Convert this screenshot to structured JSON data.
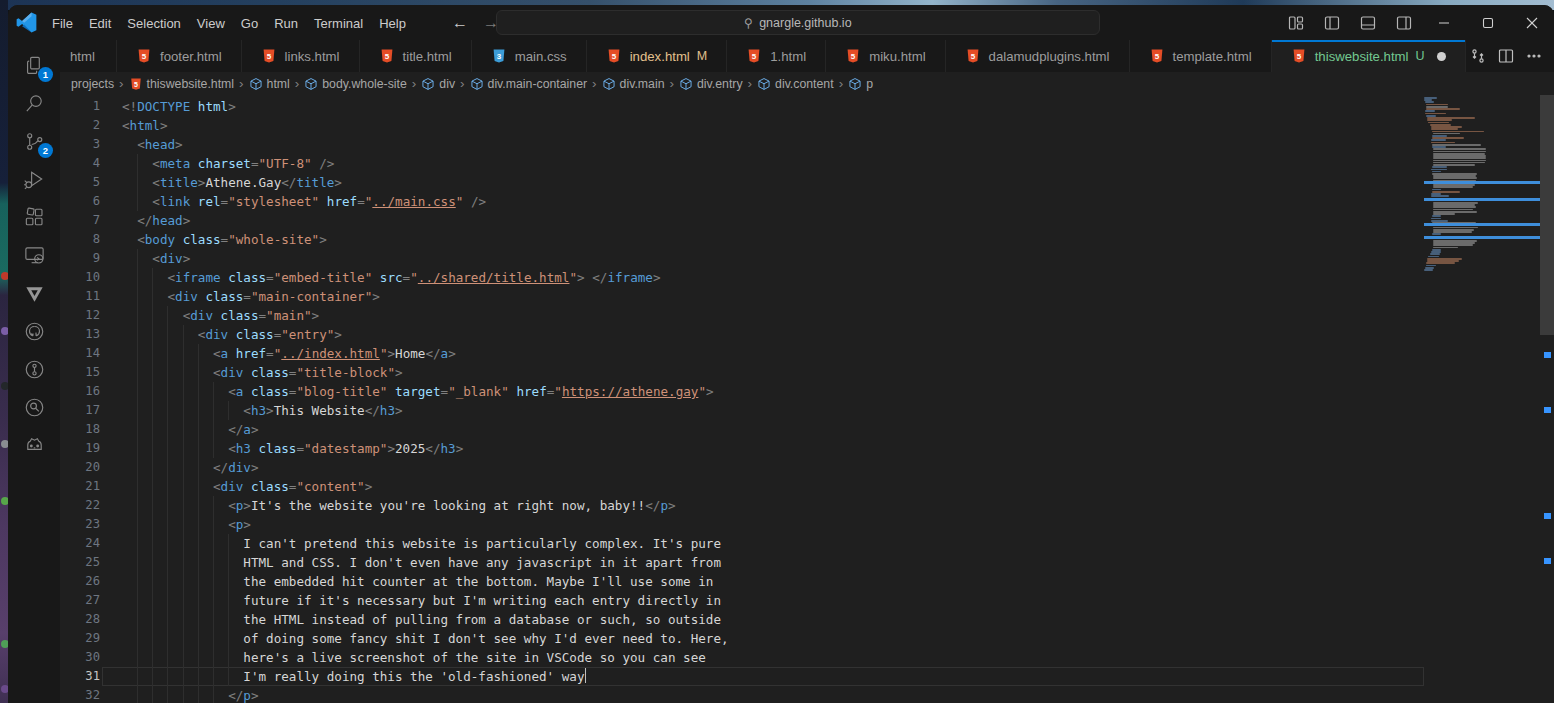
{
  "window": {
    "menu_items": [
      "File",
      "Edit",
      "Selection",
      "View",
      "Go",
      "Run",
      "Terminal",
      "Help"
    ],
    "command_center": "gnargle.github.io",
    "controls": [
      "minimize",
      "maximize",
      "close"
    ],
    "layout_controls": [
      "customize-layout",
      "toggle-primary-sidebar",
      "toggle-panel",
      "toggle-secondary-sidebar"
    ]
  },
  "activity_bar": {
    "items": [
      {
        "name": "explorer",
        "badge": "1"
      },
      {
        "name": "search",
        "badge": null
      },
      {
        "name": "source-control",
        "badge": "2"
      },
      {
        "name": "run-and-debug",
        "badge": null
      },
      {
        "name": "extensions",
        "badge": null
      },
      {
        "name": "remote-explorer",
        "badge": null
      },
      {
        "name": "triangle-logo",
        "badge": null
      },
      {
        "name": "github",
        "badge": null
      },
      {
        "name": "gitlens",
        "badge": null
      },
      {
        "name": "gitlens-search",
        "badge": null
      },
      {
        "name": "godot-tools",
        "badge": null
      }
    ]
  },
  "tabs": [
    {
      "label": "html",
      "icon": null,
      "badge": null,
      "git": null,
      "active": false,
      "dirty": false,
      "truncated": true
    },
    {
      "label": "footer.html",
      "icon": "html",
      "badge": null,
      "git": null,
      "active": false,
      "dirty": false
    },
    {
      "label": "links.html",
      "icon": "html",
      "badge": null,
      "git": null,
      "active": false,
      "dirty": false
    },
    {
      "label": "title.html",
      "icon": "html",
      "badge": null,
      "git": null,
      "active": false,
      "dirty": false
    },
    {
      "label": "main.css",
      "icon": "css",
      "badge": null,
      "git": null,
      "active": false,
      "dirty": false
    },
    {
      "label": "index.html",
      "icon": "html",
      "badge": "M",
      "git": "modified",
      "active": false,
      "dirty": false
    },
    {
      "label": "1.html",
      "icon": "html",
      "badge": null,
      "git": null,
      "active": false,
      "dirty": false
    },
    {
      "label": "miku.html",
      "icon": "html",
      "badge": null,
      "git": null,
      "active": false,
      "dirty": false
    },
    {
      "label": "dalamudplugins.html",
      "icon": "html",
      "badge": null,
      "git": null,
      "active": false,
      "dirty": false
    },
    {
      "label": "template.html",
      "icon": "html",
      "badge": null,
      "git": null,
      "active": false,
      "dirty": false
    },
    {
      "label": "thiswebsite.html",
      "icon": "html",
      "badge": "U",
      "git": "untracked",
      "active": true,
      "dirty": true
    }
  ],
  "editor_actions": [
    "open-changes",
    "split-editor",
    "more-actions"
  ],
  "breadcrumbs": [
    {
      "label": "projects",
      "icon": null
    },
    {
      "label": "thiswebsite.html",
      "icon": "html"
    },
    {
      "label": "html",
      "icon": "symbol"
    },
    {
      "label": "body.whole-site",
      "icon": "symbol"
    },
    {
      "label": "div",
      "icon": "symbol"
    },
    {
      "label": "div.main-container",
      "icon": "symbol"
    },
    {
      "label": "div.main",
      "icon": "symbol"
    },
    {
      "label": "div.entry",
      "icon": "symbol"
    },
    {
      "label": "div.content",
      "icon": "symbol"
    },
    {
      "label": "p",
      "icon": "symbol"
    }
  ],
  "editor": {
    "current_line": 31,
    "lines": [
      {
        "n": 1,
        "i": 0,
        "tokens": [
          [
            "p",
            "<!"
          ],
          [
            "t",
            "DOCTYPE"
          ],
          [
            "x",
            " "
          ],
          [
            "a",
            "html"
          ],
          [
            "p",
            ">"
          ]
        ]
      },
      {
        "n": 2,
        "i": 0,
        "tokens": [
          [
            "p",
            "<"
          ],
          [
            "t",
            "html"
          ],
          [
            "p",
            ">"
          ]
        ]
      },
      {
        "n": 3,
        "i": 2,
        "tokens": [
          [
            "p",
            "<"
          ],
          [
            "t",
            "head"
          ],
          [
            "p",
            ">"
          ]
        ]
      },
      {
        "n": 4,
        "i": 4,
        "tokens": [
          [
            "p",
            "<"
          ],
          [
            "t",
            "meta"
          ],
          [
            "x",
            " "
          ],
          [
            "a",
            "charset"
          ],
          [
            "p",
            "="
          ],
          [
            "s",
            "\"UTF-8\""
          ],
          [
            "x",
            " "
          ],
          [
            "p",
            "/>"
          ]
        ]
      },
      {
        "n": 5,
        "i": 4,
        "tokens": [
          [
            "p",
            "<"
          ],
          [
            "t",
            "title"
          ],
          [
            "p",
            ">"
          ],
          [
            "x",
            "Athene.Gay"
          ],
          [
            "p",
            "</"
          ],
          [
            "t",
            "title"
          ],
          [
            "p",
            ">"
          ]
        ]
      },
      {
        "n": 6,
        "i": 4,
        "tokens": [
          [
            "p",
            "<"
          ],
          [
            "t",
            "link"
          ],
          [
            "x",
            " "
          ],
          [
            "a",
            "rel"
          ],
          [
            "p",
            "="
          ],
          [
            "s",
            "\"stylesheet\""
          ],
          [
            "x",
            " "
          ],
          [
            "a",
            "href"
          ],
          [
            "p",
            "="
          ],
          [
            "s",
            "\""
          ],
          [
            "l",
            "../main.css"
          ],
          [
            "s",
            "\""
          ],
          [
            "x",
            " "
          ],
          [
            "p",
            "/>"
          ]
        ]
      },
      {
        "n": 7,
        "i": 2,
        "tokens": [
          [
            "p",
            "</"
          ],
          [
            "t",
            "head"
          ],
          [
            "p",
            ">"
          ]
        ]
      },
      {
        "n": 8,
        "i": 2,
        "tokens": [
          [
            "p",
            "<"
          ],
          [
            "t",
            "body"
          ],
          [
            "x",
            " "
          ],
          [
            "a",
            "class"
          ],
          [
            "p",
            "="
          ],
          [
            "s",
            "\"whole-site\""
          ],
          [
            "p",
            ">"
          ]
        ]
      },
      {
        "n": 9,
        "i": 4,
        "tokens": [
          [
            "p",
            "<"
          ],
          [
            "t",
            "div"
          ],
          [
            "p",
            ">"
          ]
        ]
      },
      {
        "n": 10,
        "i": 6,
        "tokens": [
          [
            "p",
            "<"
          ],
          [
            "t",
            "iframe"
          ],
          [
            "x",
            " "
          ],
          [
            "a",
            "class"
          ],
          [
            "p",
            "="
          ],
          [
            "s",
            "\"embed-title\""
          ],
          [
            "x",
            " "
          ],
          [
            "a",
            "src"
          ],
          [
            "p",
            "="
          ],
          [
            "s",
            "\""
          ],
          [
            "l",
            "../shared/title.html"
          ],
          [
            "s",
            "\""
          ],
          [
            "p",
            ">"
          ],
          [
            "x",
            " "
          ],
          [
            "p",
            "</"
          ],
          [
            "t",
            "iframe"
          ],
          [
            "p",
            ">"
          ]
        ]
      },
      {
        "n": 11,
        "i": 6,
        "tokens": [
          [
            "p",
            "<"
          ],
          [
            "t",
            "div"
          ],
          [
            "x",
            " "
          ],
          [
            "a",
            "class"
          ],
          [
            "p",
            "="
          ],
          [
            "s",
            "\"main-container\""
          ],
          [
            "p",
            ">"
          ]
        ]
      },
      {
        "n": 12,
        "i": 8,
        "tokens": [
          [
            "p",
            "<"
          ],
          [
            "t",
            "div"
          ],
          [
            "x",
            " "
          ],
          [
            "a",
            "class"
          ],
          [
            "p",
            "="
          ],
          [
            "s",
            "\"main\""
          ],
          [
            "p",
            ">"
          ]
        ]
      },
      {
        "n": 13,
        "i": 10,
        "tokens": [
          [
            "p",
            "<"
          ],
          [
            "t",
            "div"
          ],
          [
            "x",
            " "
          ],
          [
            "a",
            "class"
          ],
          [
            "p",
            "="
          ],
          [
            "s",
            "\"entry\""
          ],
          [
            "p",
            ">"
          ]
        ]
      },
      {
        "n": 14,
        "i": 12,
        "tokens": [
          [
            "p",
            "<"
          ],
          [
            "t",
            "a"
          ],
          [
            "x",
            " "
          ],
          [
            "a",
            "href"
          ],
          [
            "p",
            "="
          ],
          [
            "s",
            "\""
          ],
          [
            "l",
            "../index.html"
          ],
          [
            "s",
            "\""
          ],
          [
            "p",
            ">"
          ],
          [
            "x",
            "Home"
          ],
          [
            "p",
            "</"
          ],
          [
            "t",
            "a"
          ],
          [
            "p",
            ">"
          ]
        ]
      },
      {
        "n": 15,
        "i": 12,
        "tokens": [
          [
            "p",
            "<"
          ],
          [
            "t",
            "div"
          ],
          [
            "x",
            " "
          ],
          [
            "a",
            "class"
          ],
          [
            "p",
            "="
          ],
          [
            "s",
            "\"title-block\""
          ],
          [
            "p",
            ">"
          ]
        ]
      },
      {
        "n": 16,
        "i": 14,
        "tokens": [
          [
            "p",
            "<"
          ],
          [
            "t",
            "a"
          ],
          [
            "x",
            " "
          ],
          [
            "a",
            "class"
          ],
          [
            "p",
            "="
          ],
          [
            "s",
            "\"blog-title\""
          ],
          [
            "x",
            " "
          ],
          [
            "a",
            "target"
          ],
          [
            "p",
            "="
          ],
          [
            "s",
            "\"_blank\""
          ],
          [
            "x",
            " "
          ],
          [
            "a",
            "href"
          ],
          [
            "p",
            "="
          ],
          [
            "s",
            "\""
          ],
          [
            "l",
            "https://athene.gay"
          ],
          [
            "s",
            "\""
          ],
          [
            "p",
            ">"
          ]
        ]
      },
      {
        "n": 17,
        "i": 16,
        "tokens": [
          [
            "p",
            "<"
          ],
          [
            "t",
            "h3"
          ],
          [
            "p",
            ">"
          ],
          [
            "x",
            "This Website"
          ],
          [
            "p",
            "</"
          ],
          [
            "t",
            "h3"
          ],
          [
            "p",
            ">"
          ]
        ]
      },
      {
        "n": 18,
        "i": 14,
        "tokens": [
          [
            "p",
            "</"
          ],
          [
            "t",
            "a"
          ],
          [
            "p",
            ">"
          ]
        ]
      },
      {
        "n": 19,
        "i": 14,
        "tokens": [
          [
            "p",
            "<"
          ],
          [
            "t",
            "h3"
          ],
          [
            "x",
            " "
          ],
          [
            "a",
            "class"
          ],
          [
            "p",
            "="
          ],
          [
            "s",
            "\"datestamp\""
          ],
          [
            "p",
            ">"
          ],
          [
            "x",
            "2025"
          ],
          [
            "p",
            "</"
          ],
          [
            "t",
            "h3"
          ],
          [
            "p",
            ">"
          ]
        ]
      },
      {
        "n": 20,
        "i": 12,
        "tokens": [
          [
            "p",
            "</"
          ],
          [
            "t",
            "div"
          ],
          [
            "p",
            ">"
          ]
        ]
      },
      {
        "n": 21,
        "i": 12,
        "tokens": [
          [
            "p",
            "<"
          ],
          [
            "t",
            "div"
          ],
          [
            "x",
            " "
          ],
          [
            "a",
            "class"
          ],
          [
            "p",
            "="
          ],
          [
            "s",
            "\"content\""
          ],
          [
            "p",
            ">"
          ]
        ]
      },
      {
        "n": 22,
        "i": 14,
        "tokens": [
          [
            "p",
            "<"
          ],
          [
            "t",
            "p"
          ],
          [
            "p",
            ">"
          ],
          [
            "x",
            "It's the website you're looking at right now, baby!!"
          ],
          [
            "p",
            "</"
          ],
          [
            "t",
            "p"
          ],
          [
            "p",
            ">"
          ]
        ]
      },
      {
        "n": 23,
        "i": 14,
        "tokens": [
          [
            "p",
            "<"
          ],
          [
            "t",
            "p"
          ],
          [
            "p",
            ">"
          ]
        ]
      },
      {
        "n": 24,
        "i": 16,
        "tokens": [
          [
            "x",
            "I can't pretend this website is particularly complex. It's pure"
          ]
        ]
      },
      {
        "n": 25,
        "i": 16,
        "tokens": [
          [
            "x",
            "HTML and CSS. I don't even have any javascript in it apart from"
          ]
        ]
      },
      {
        "n": 26,
        "i": 16,
        "tokens": [
          [
            "x",
            "the embedded hit counter at the bottom. Maybe I'll use some in"
          ]
        ]
      },
      {
        "n": 27,
        "i": 16,
        "tokens": [
          [
            "x",
            "future if it's necessary but I'm writing each entry directly in"
          ]
        ]
      },
      {
        "n": 28,
        "i": 16,
        "tokens": [
          [
            "x",
            "the HTML instead of pulling from a database or such, so outside"
          ]
        ]
      },
      {
        "n": 29,
        "i": 16,
        "tokens": [
          [
            "x",
            "of doing some fancy shit I don't see why I'd ever need to. Here,"
          ]
        ]
      },
      {
        "n": 30,
        "i": 16,
        "tokens": [
          [
            "x",
            "here's a live screenshot of the site in VSCode so you can see"
          ]
        ]
      },
      {
        "n": 31,
        "i": 16,
        "tokens": [
          [
            "x",
            "I'm really doing this the 'old-fashioned' way"
          ],
          [
            "caret",
            ""
          ]
        ]
      },
      {
        "n": 32,
        "i": 14,
        "tokens": [
          [
            "p",
            "</"
          ],
          [
            "t",
            "p"
          ],
          [
            "p",
            ">"
          ]
        ]
      }
    ]
  },
  "colors": {
    "accent_blue": "#0078d4",
    "git_modified": "#e2c08d",
    "git_untracked": "#73c991",
    "html_icon_orange": "#e44d26",
    "css_icon_blue": "#519aba",
    "editor_bg": "#1f1f1f",
    "chrome_bg": "#181818"
  }
}
